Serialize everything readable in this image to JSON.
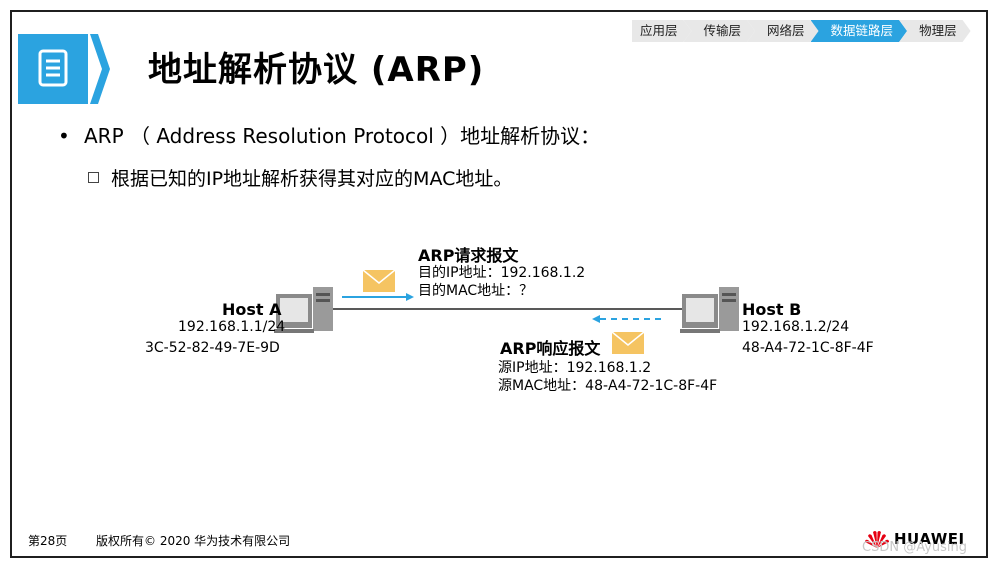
{
  "breadcrumb": [
    "应用层",
    "传输层",
    "网络层",
    "数据链路层",
    "物理层"
  ],
  "breadcrumb_active_index": 3,
  "title": "地址解析协议 (ARP)",
  "bullet1": "ARP （ Address Resolution Protocol ）地址解析协议：",
  "bullet2": "根据已知的IP地址解析获得其对应的MAC地址。",
  "host_a": {
    "name": "Host A",
    "ip": "192.168.1.1/24",
    "mac": "3C-52-82-49-7E-9D"
  },
  "host_b": {
    "name": "Host B",
    "ip": "192.168.1.2/24",
    "mac": "48-A4-72-1C-8F-4F"
  },
  "request": {
    "title": "ARP请求报文",
    "line1": "目的IP地址：192.168.1.2",
    "line2": "目的MAC地址：？"
  },
  "reply": {
    "title": "ARP响应报文",
    "line1": "源IP地址：192.168.1.2",
    "line2": "源MAC地址：48-A4-72-1C-8F-4F"
  },
  "footer": {
    "page": "第28页",
    "copyright": "版权所有© 2020 华为技术有限公司",
    "brand": "HUAWEI"
  },
  "watermark": "CSDN @Ayusing",
  "colors": {
    "accent": "#2ba3e0",
    "envelope": "#f5c462",
    "icon_bg": "#2ba3e0"
  }
}
